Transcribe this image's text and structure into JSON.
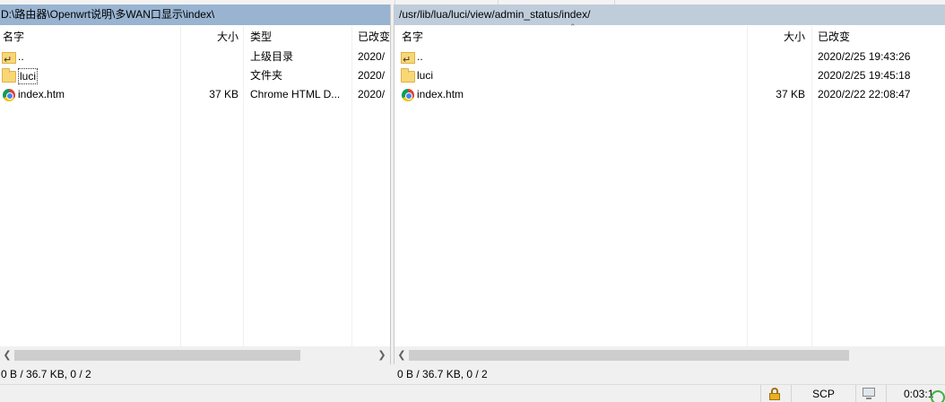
{
  "left_panel": {
    "path": "D:\\路由器\\Openwrt说明\\多WAN口显示\\index\\",
    "columns": [
      "名字",
      "大小",
      "类型",
      "已改变"
    ],
    "rows": [
      {
        "name": "..",
        "icon": "up-folder-icon",
        "size": "",
        "type": "上级目录",
        "changed": "2020/"
      },
      {
        "name": "luci",
        "icon": "folder-icon",
        "size": "",
        "type": "文件夹",
        "changed": "2020/"
      },
      {
        "name": "index.htm",
        "icon": "chrome-icon",
        "size": "37 KB",
        "type": "Chrome HTML D...",
        "changed": "2020/"
      }
    ],
    "status": "0 B / 36.7 KB,   0 / 2"
  },
  "right_panel": {
    "path": "/usr/lib/lua/luci/view/admin_status/index/",
    "columns": [
      "名字",
      "大小",
      "已改变"
    ],
    "rows": [
      {
        "name": "..",
        "icon": "up-folder-icon",
        "size": "",
        "changed": "2020/2/25 19:43:26"
      },
      {
        "name": "luci",
        "icon": "folder-icon",
        "size": "",
        "changed": "2020/2/25 19:45:18"
      },
      {
        "name": "index.htm",
        "icon": "chrome-icon",
        "size": "37 KB",
        "changed": "2020/2/22 22:08:47"
      }
    ],
    "status": "0 B / 36.7 KB,   0 / 2"
  },
  "bottom_bar": {
    "protocol": "SCP",
    "time": "0:03:1"
  },
  "colors": {
    "left_path_bg": "#99b4d1",
    "right_path_bg": "#bfcddb",
    "scroll_thumb": "#cdcdcd"
  }
}
